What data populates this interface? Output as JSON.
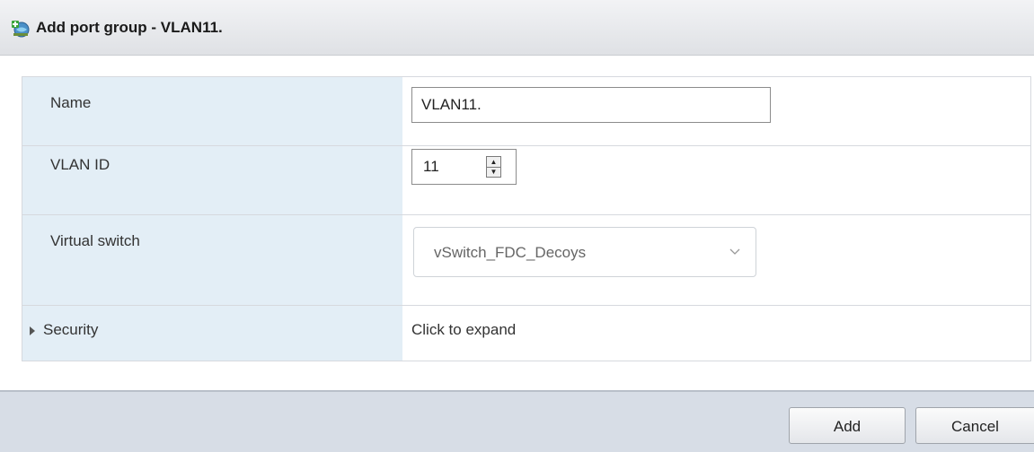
{
  "dialog": {
    "title": "Add port group - VLAN11.",
    "title_icon": "network-add-icon"
  },
  "form": {
    "name": {
      "label": "Name",
      "value": "VLAN11."
    },
    "vlan_id": {
      "label": "VLAN ID",
      "value": "11"
    },
    "virtual_switch": {
      "label": "Virtual switch",
      "selected": "vSwitch_FDC_Decoys"
    },
    "security": {
      "label": "Security",
      "value": "Click to expand",
      "expanded": false
    }
  },
  "footer": {
    "add_label": "Add",
    "cancel_label": "Cancel"
  },
  "colors": {
    "label_bg": "#e3eef6",
    "footer_bg": "#d7dde6",
    "title_bg": "#e6e8eb"
  }
}
